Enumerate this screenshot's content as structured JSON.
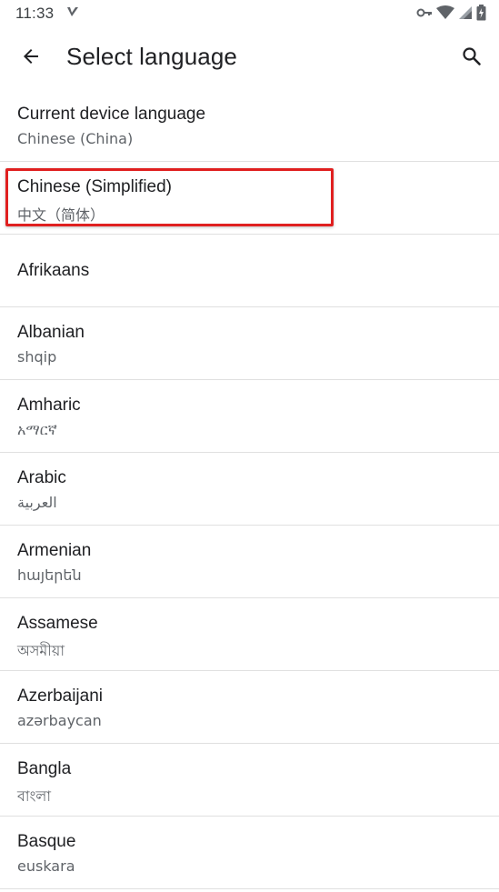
{
  "status_bar": {
    "time": "11:33",
    "icons": [
      "app-notification-icon",
      "vpn-key-icon",
      "wifi-icon",
      "cell-signal-icon",
      "battery-charging-icon"
    ]
  },
  "app_bar": {
    "title": "Select language",
    "back_icon": "arrow-back-icon",
    "search_icon": "search-icon"
  },
  "languages": [
    {
      "name": "Current device language",
      "native": "Chinese (China)"
    },
    {
      "name": "Chinese (Simplified)",
      "native": "中文（简体）",
      "highlighted": true
    },
    {
      "name": "Afrikaans",
      "native": ""
    },
    {
      "name": "Albanian",
      "native": "shqip"
    },
    {
      "name": "Amharic",
      "native": "አማርኛ"
    },
    {
      "name": "Arabic",
      "native": "العربية"
    },
    {
      "name": "Armenian",
      "native": "հայերեն"
    },
    {
      "name": "Assamese",
      "native": "অসমীয়া"
    },
    {
      "name": "Azerbaijani",
      "native": "azərbaycan"
    },
    {
      "name": "Bangla",
      "native": "বাংলা"
    },
    {
      "name": "Basque",
      "native": "euskara"
    }
  ],
  "colors": {
    "highlight": "#e02020",
    "divider": "#e0e0e0",
    "primary_text": "#202124",
    "secondary_text": "#5f6368"
  }
}
